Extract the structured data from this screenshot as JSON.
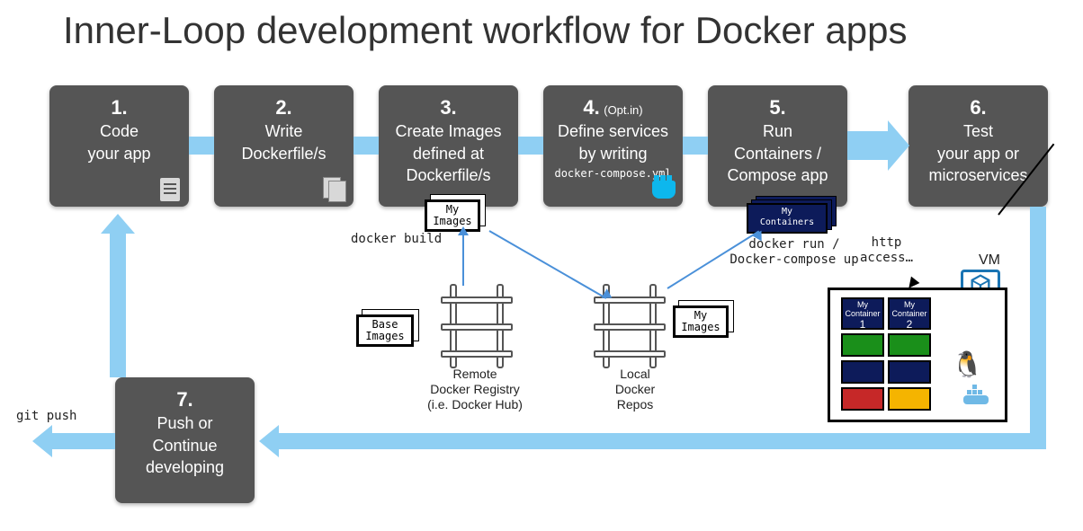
{
  "title": "Inner-Loop development workflow for Docker apps",
  "steps": {
    "s1": {
      "num": "1.",
      "l1": "Code",
      "l2": "your app"
    },
    "s2": {
      "num": "2.",
      "l1": "Write",
      "l2": "Dockerfile/s"
    },
    "s3": {
      "num": "3.",
      "l1": "Create Images",
      "l2": "defined at",
      "l3": "Dockerfile/s"
    },
    "s4": {
      "num": "4.",
      "opt": "(Opt.in)",
      "l1": "Define services",
      "l2": "by writing",
      "sm": "docker-compose.yml"
    },
    "s5": {
      "num": "5.",
      "l1": "Run",
      "l2": "Containers /",
      "l3": "Compose app"
    },
    "s6": {
      "num": "6.",
      "l1": "Test",
      "l2": "your app or",
      "l3": "microservices"
    },
    "s7": {
      "num": "7.",
      "l1": "Push or",
      "l2": "Continue",
      "l3": "developing"
    }
  },
  "cards": {
    "my_images_top": {
      "l1": "My",
      "l2": "Images"
    },
    "base_images": {
      "l1": "Base",
      "l2": "Images"
    },
    "my_images_local": {
      "l1": "My",
      "l2": "Images"
    },
    "my_containers": {
      "l1": "My",
      "l2": "Containers"
    }
  },
  "labels": {
    "docker_build": "docker build",
    "remote_registry_l1": "Remote",
    "remote_registry_l2": "Docker Registry",
    "remote_registry_l3": "(i.e. Docker Hub)",
    "local_repos_l1": "Local",
    "local_repos_l2": "Docker",
    "local_repos_l3": "Repos",
    "docker_run_l1": "docker run /",
    "docker_run_l2": "Docker-compose up",
    "http_l1": "http",
    "http_l2": "access…",
    "vm": "VM",
    "git_push": "git push"
  },
  "vm": {
    "c1": {
      "l1": "My",
      "l2": "Container",
      "n": "1"
    },
    "c2": {
      "l1": "My",
      "l2": "Container",
      "n": "2"
    }
  }
}
